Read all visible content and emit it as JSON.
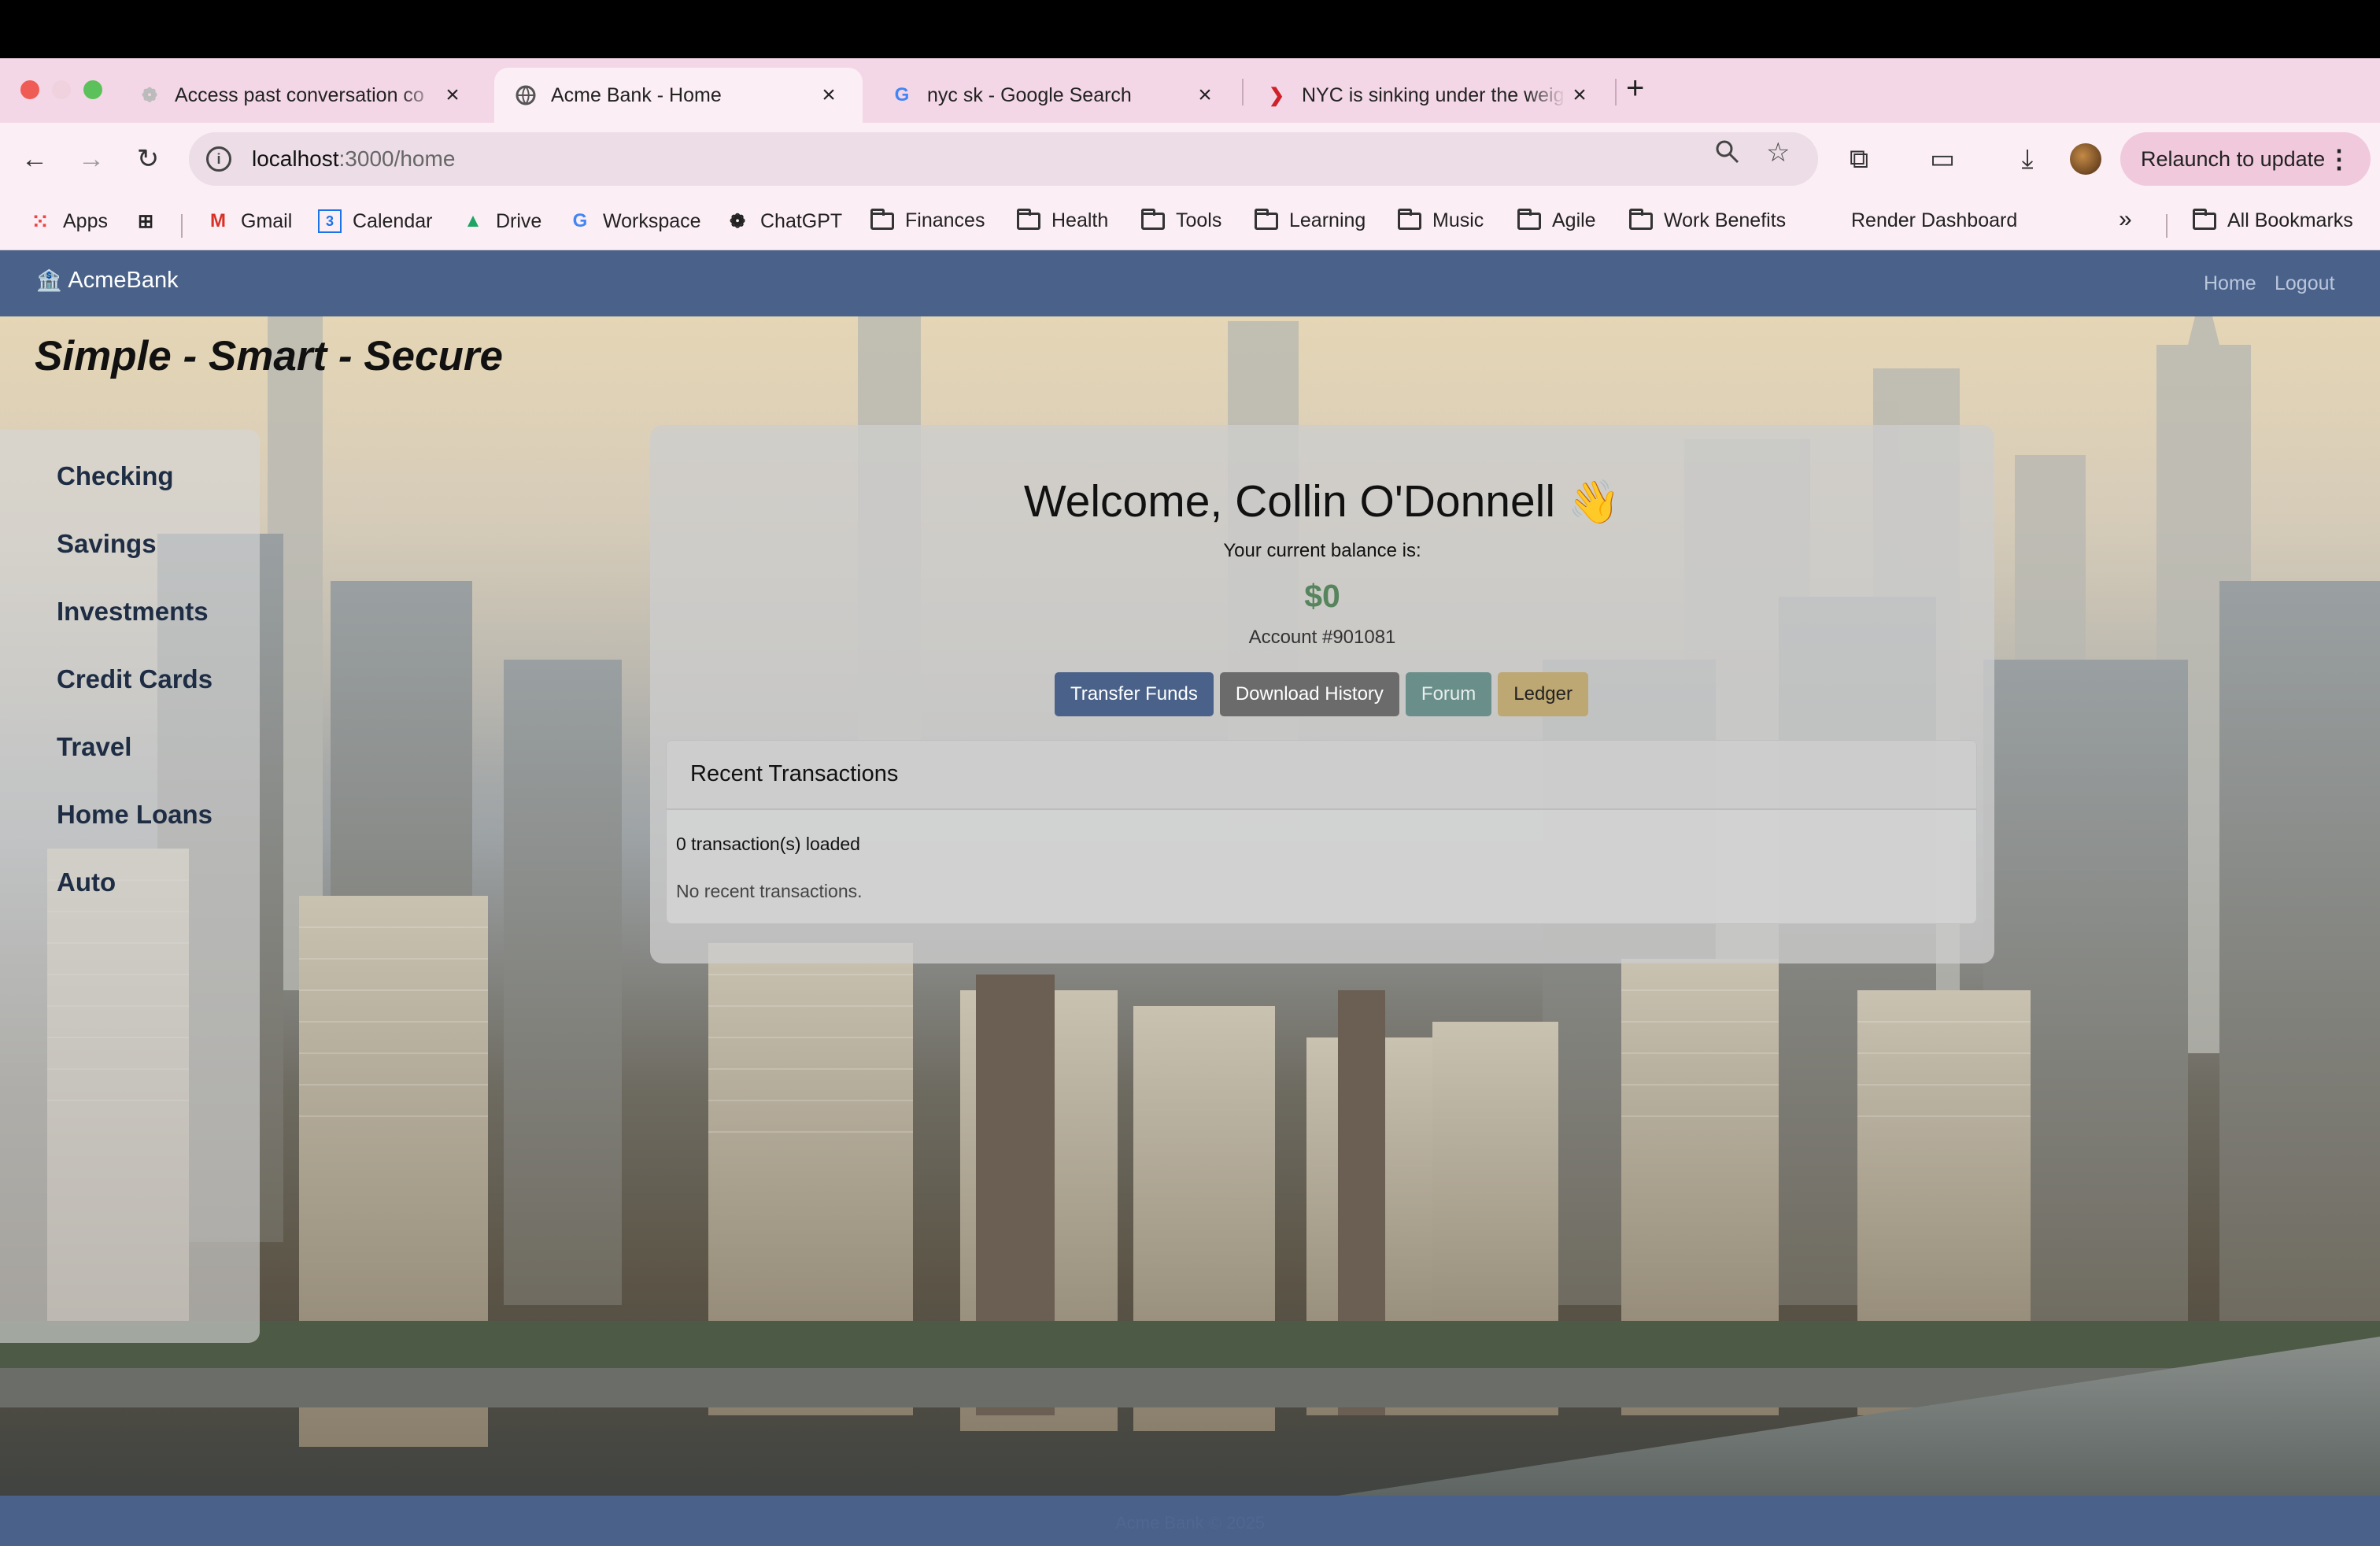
{
  "browser": {
    "tabs": [
      {
        "title": "Access past conversation co",
        "favicon": "openai-icon"
      },
      {
        "title": "Acme Bank - Home",
        "favicon": "globe-icon"
      },
      {
        "title": "nyc sk - Google Search",
        "favicon": "google-icon"
      },
      {
        "title": "NYC is sinking under the weig",
        "favicon": "news-icon"
      }
    ],
    "url_host": "localhost",
    "url_path": ":3000/home",
    "relaunch_label": "Relaunch to update",
    "bookmarks": [
      "Apps",
      "Gmail",
      "Calendar",
      "Drive",
      "Workspace",
      "ChatGPT",
      "Finances",
      "Health",
      "Tools",
      "Learning",
      "Music",
      "Agile",
      "Work Benefits",
      "Render Dashboard"
    ],
    "all_bookmarks": "All Bookmarks",
    "overflow": "»"
  },
  "navbar": {
    "brand": "AcmeBank",
    "links": [
      "Home",
      "Logout"
    ]
  },
  "slogan": "Simple - Smart - Secure",
  "sidebar": {
    "items": [
      "Checking",
      "Savings",
      "Investments",
      "Credit Cards",
      "Travel",
      "Home Loans",
      "Auto"
    ]
  },
  "main": {
    "welcome": "Welcome, Collin O'Donnell",
    "wave": "👋",
    "balance_label": "Your current balance is:",
    "balance": "$0",
    "account": "Account #901081",
    "buttons": {
      "transfer": "Transfer Funds",
      "download": "Download History",
      "forum": "Forum",
      "ledger": "Ledger"
    },
    "transactions": {
      "title": "Recent Transactions",
      "count": "0 transaction(s) loaded",
      "empty": "No recent transactions."
    }
  },
  "footer": {
    "text": "Acme Bank © 2025"
  },
  "colors": {
    "navbar": "#4a628a",
    "balance": "#56845c"
  }
}
